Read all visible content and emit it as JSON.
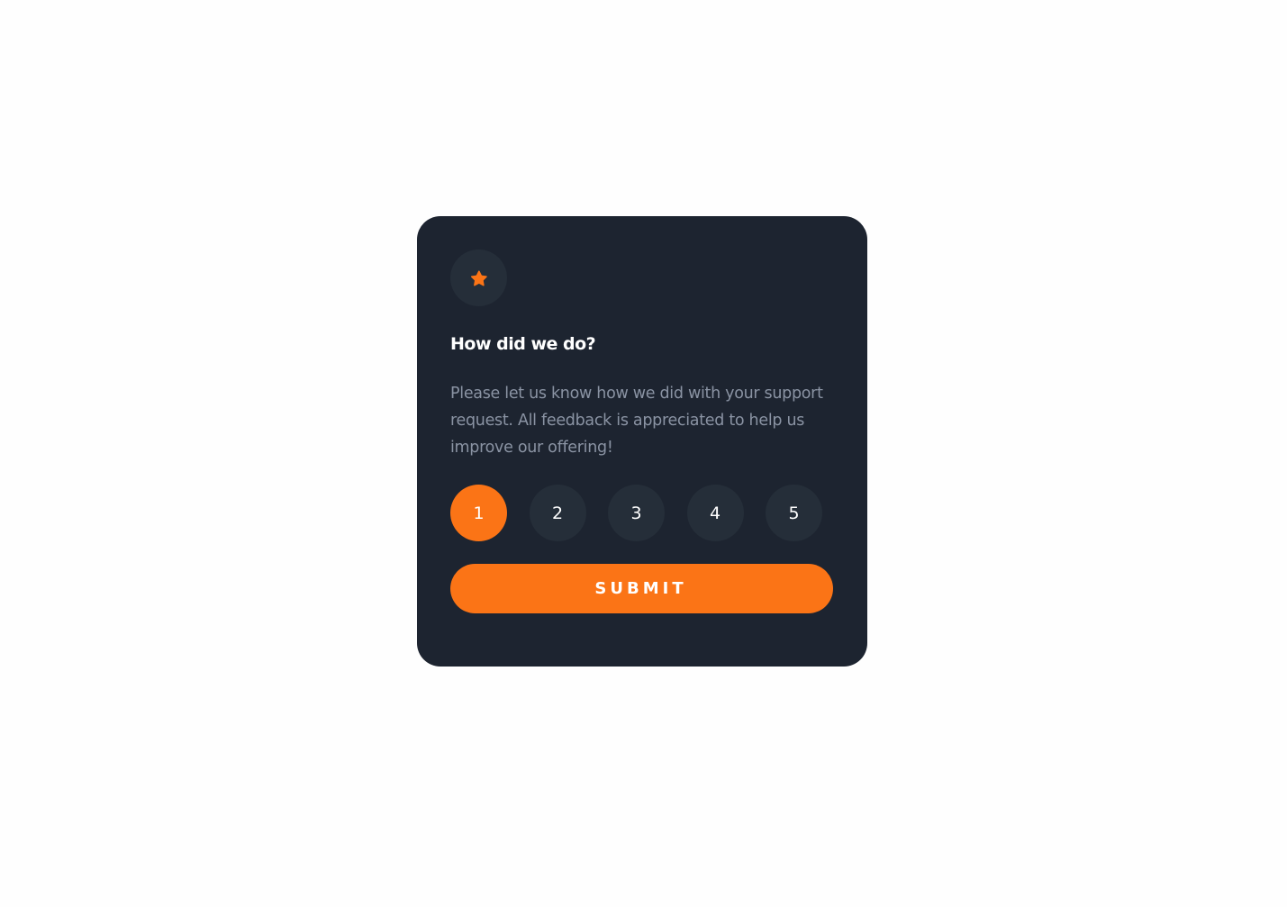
{
  "card": {
    "icon": "star-icon",
    "title": "How did we do?",
    "description": "Please let us know how we did with your support request. All feedback is appreciated to help us improve our offering!",
    "ratings": [
      "1",
      "2",
      "3",
      "4",
      "5"
    ],
    "selected_rating": "1",
    "submit_label": "SUBMIT"
  },
  "colors": {
    "page_background": "#fefefe",
    "card_background": "#1d2430",
    "circle_background": "#252e39",
    "accent": "#fb7416",
    "title_text": "#ffffff",
    "description_text": "#8a93a3"
  }
}
